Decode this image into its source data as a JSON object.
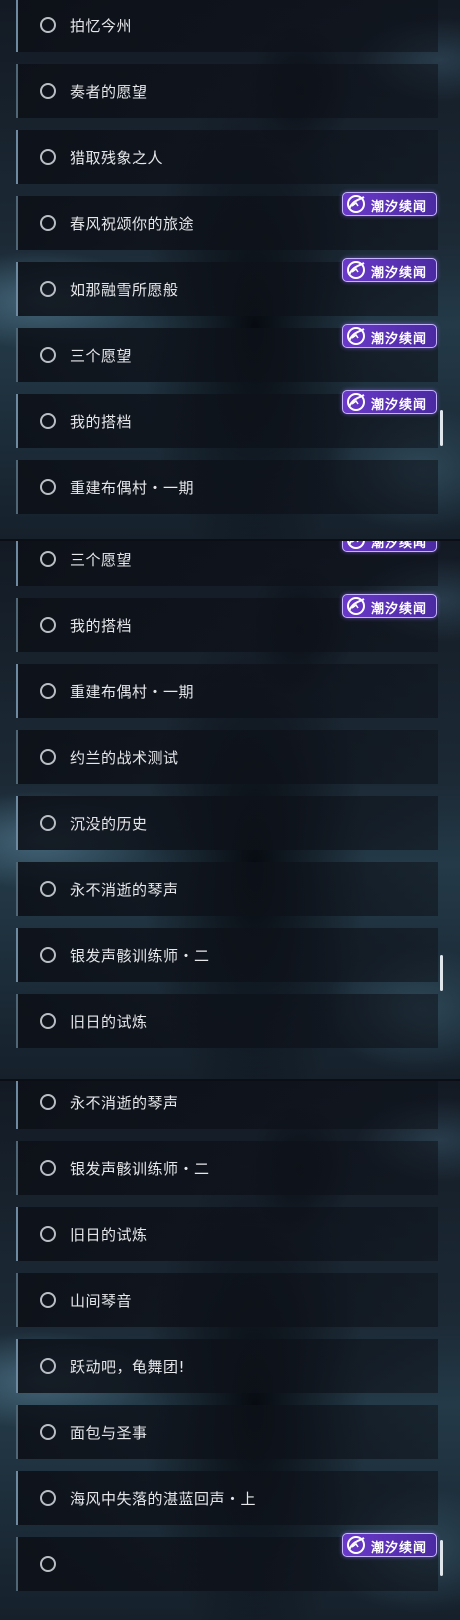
{
  "badge_text": "潮汐续闻",
  "icons": {
    "radio": "radio-circle-icon",
    "badge": "tide-mark-icon"
  },
  "colors": {
    "badge_bg": "#5b32b6",
    "badge_border": "#c6b2ff",
    "item_accent": "#6d8aa0",
    "text": "#e5e7ea"
  },
  "panels": [
    {
      "items": [
        {
          "label": "拍忆今州",
          "badge": false
        },
        {
          "label": "奏者的愿望",
          "badge": false
        },
        {
          "label": "猎取残象之人",
          "badge": false
        },
        {
          "label": "春风祝颂你的旅途",
          "badge": true
        },
        {
          "label": "如那融雪所愿般",
          "badge": true
        },
        {
          "label": "三个愿望",
          "badge": true
        },
        {
          "label": "我的搭档",
          "badge": true
        },
        {
          "label": "重建布偶村・一期",
          "badge": false
        }
      ]
    },
    {
      "items": [
        {
          "label": "三个愿望",
          "badge": true
        },
        {
          "label": "我的搭档",
          "badge": true
        },
        {
          "label": "重建布偶村・一期",
          "badge": false
        },
        {
          "label": "约兰的战术测试",
          "badge": false
        },
        {
          "label": "沉没的历史",
          "badge": false
        },
        {
          "label": "永不消逝的琴声",
          "badge": false
        },
        {
          "label": "银发声骸训练师・二",
          "badge": false
        },
        {
          "label": "旧日的试炼",
          "badge": false
        }
      ]
    },
    {
      "items": [
        {
          "label": "永不消逝的琴声",
          "badge": false
        },
        {
          "label": "银发声骸训练师・二",
          "badge": false
        },
        {
          "label": "旧日的试炼",
          "badge": false
        },
        {
          "label": "山间琴音",
          "badge": false
        },
        {
          "label": "跃动吧，龟舞团!",
          "badge": false
        },
        {
          "label": "面包与圣事",
          "badge": false
        },
        {
          "label": "海风中失落的湛蓝回声・上",
          "badge": false
        },
        {
          "label": "",
          "badge": true
        }
      ]
    }
  ]
}
